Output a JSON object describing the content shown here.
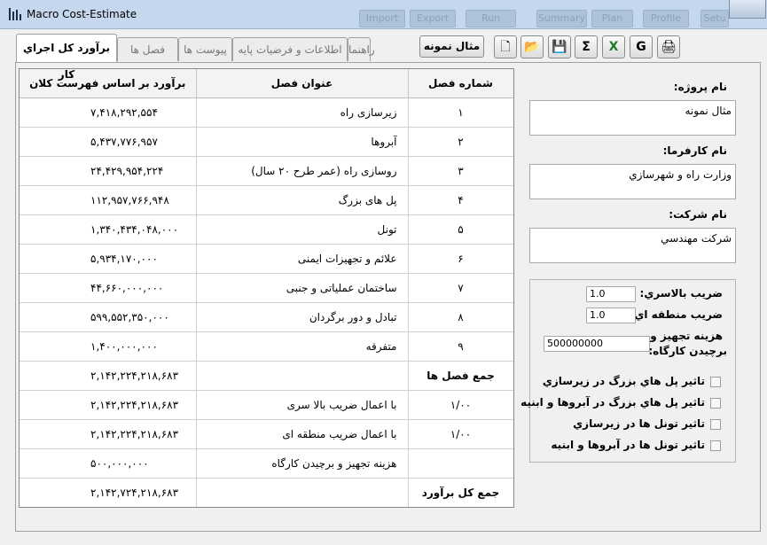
{
  "window": {
    "title": "Macro Cost-Estimate",
    "background_buttons": [
      "Import",
      "Export",
      "Run",
      "Summary",
      "Plan",
      "Profile",
      "Setu"
    ]
  },
  "tabs": [
    {
      "label": "برآورد كل اجراي كار",
      "active": true
    },
    {
      "label": "فصل ها",
      "active": false
    },
    {
      "label": "پیوست ها",
      "active": false
    },
    {
      "label": "اطلاعات و فرضيات پايه",
      "active": false
    },
    {
      "label": "راهنما",
      "active": false
    }
  ],
  "toolbar": {
    "example_label": "مثال نمونه",
    "tools": [
      {
        "name": "new-file-icon",
        "glyph": "🗋"
      },
      {
        "name": "open-folder-icon",
        "glyph": "📂"
      },
      {
        "name": "save-icon",
        "glyph": "💾"
      },
      {
        "name": "sum-icon",
        "glyph": "Σ"
      },
      {
        "name": "excel-icon",
        "glyph": "X"
      },
      {
        "name": "g-icon",
        "glyph": "G"
      },
      {
        "name": "print-icon",
        "glyph": "🖨"
      }
    ]
  },
  "table": {
    "columns": {
      "number": "شماره فصل",
      "title": "عنوان فصل",
      "amount": "برآورد بر اساس فهرست كلان"
    },
    "rows": [
      {
        "number": "۱",
        "title": "زیرسازی راه",
        "amount": "۷,۴۱۸,۲۹۲,۵۵۴"
      },
      {
        "number": "۲",
        "title": "آبروها",
        "amount": "۵,۴۳۷,۷۷۶,۹۵۷"
      },
      {
        "number": "۳",
        "title": "روسازی راه (عمر طرح ۲۰ سال)",
        "amount": "۲۴,۴۲۹,۹۵۴,۲۲۴"
      },
      {
        "number": "۴",
        "title": "پل های بزرگ",
        "amount": "۱۱۲,۹۵۷,۷۶۶,۹۴۸"
      },
      {
        "number": "۵",
        "title": "تونل",
        "amount": "۱,۳۴۰,۴۳۴,۰۴۸,۰۰۰"
      },
      {
        "number": "۶",
        "title": "علائم و تجهیزات ایمنی",
        "amount": "۵,۹۳۴,۱۷۰,۰۰۰"
      },
      {
        "number": "۷",
        "title": "ساختمان عملیاتی و جنبی",
        "amount": "۴۴,۶۶۰,۰۰۰,۰۰۰"
      },
      {
        "number": "۸",
        "title": "تبادل و دور برگردان",
        "amount": "۵۹۹,۵۵۲,۳۵۰,۰۰۰"
      },
      {
        "number": "۹",
        "title": "متفرقه",
        "amount": "۱,۴۰۰,۰۰۰,۰۰۰"
      },
      {
        "number": "جمع فصل ها",
        "title": "",
        "amount": "۲,۱۴۲,۲۲۴,۲۱۸,۶۸۳",
        "bold": true
      },
      {
        "number": "۱/۰۰",
        "title": "با اعمال ضریب بالا سری",
        "amount": "۲,۱۴۲,۲۲۴,۲۱۸,۶۸۳"
      },
      {
        "number": "۱/۰۰",
        "title": "با اعمال ضریب منطقه ای",
        "amount": "۲,۱۴۲,۲۲۴,۲۱۸,۶۸۳"
      },
      {
        "number": "",
        "title": "هزینه تجهیز و برچیدن کارگاه",
        "amount": "۵۰۰,۰۰۰,۰۰۰"
      },
      {
        "number": "جمع کل برآورد",
        "title": "",
        "amount": "۲,۱۴۲,۷۲۴,۲۱۸,۶۸۳",
        "bold": true
      }
    ]
  },
  "form": {
    "project_label": "نام پروژه:",
    "project_value": "مثال نمونه",
    "employer_label": "نام كارفرما:",
    "employer_value": "وزارت راه و شهرسازي",
    "company_label": "نام شركت:",
    "company_value": "شركت مهندسي",
    "overhead_label": "ضريب بالاسري:",
    "overhead_value": "1.0",
    "regional_label": "ضريب منطقه اي:",
    "regional_value": "1.0",
    "workshop_label_1": "هزينه تجهيز و",
    "workshop_label_2": "برچيدن كارگاه:",
    "workshop_value": "500000000",
    "checkboxes": [
      "تاثير پل هاي بزرگ در زيرسازي",
      "تاثير پل هاي بزرگ در آبروها و ابنيه",
      "تاثير تونل ها در زيرسازي",
      "تاثير تونل ها در آبروها و ابنيه"
    ]
  }
}
